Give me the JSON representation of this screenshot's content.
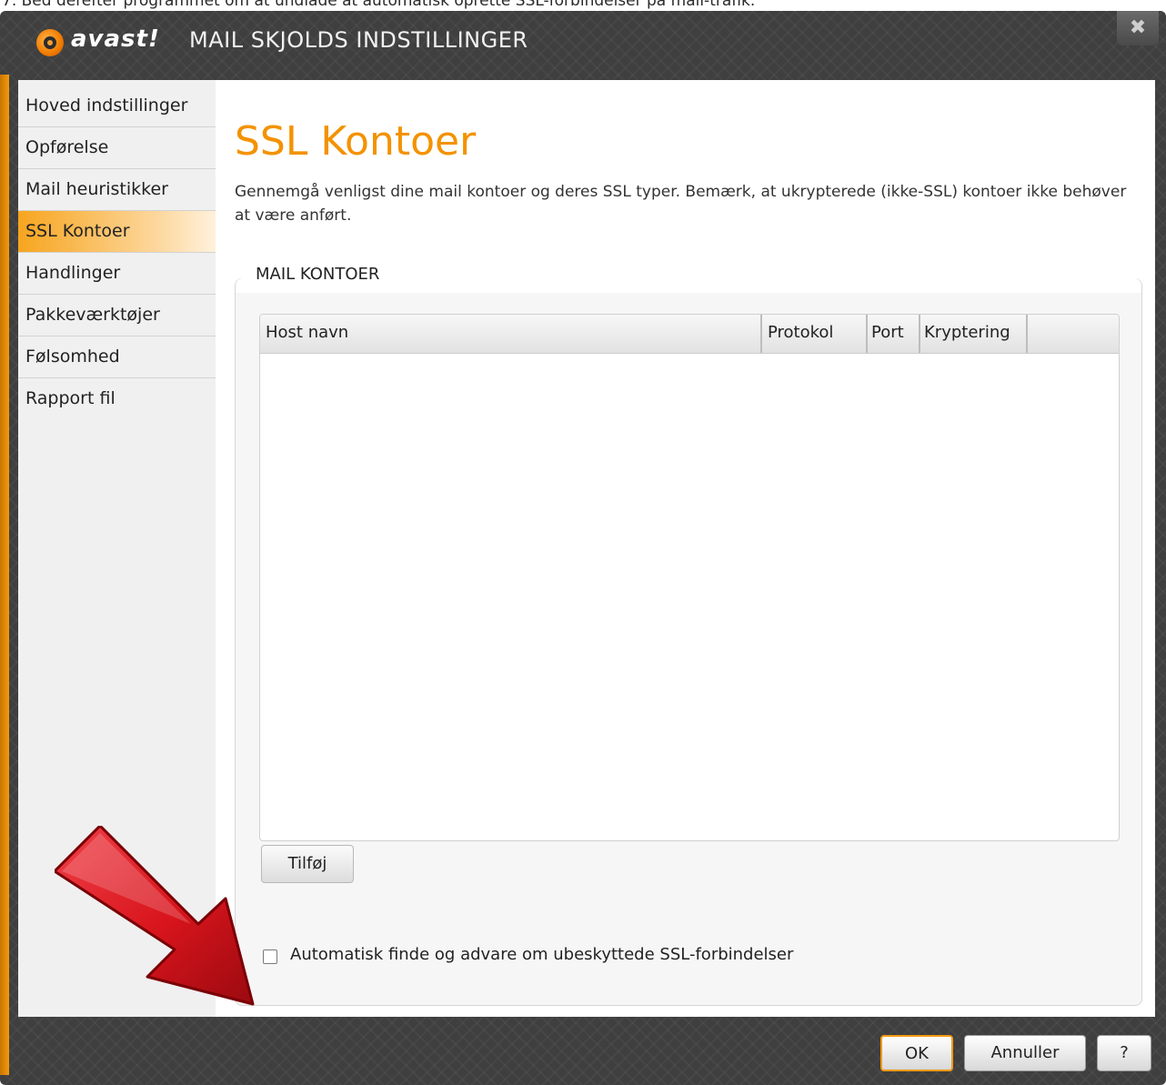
{
  "caption": "7. Bed derefter programmet om at undlade at automatisk oprette SSL-forbindelser på mail-trafik.",
  "window": {
    "logo_text": "avast!",
    "title": "MAIL SKJOLDS INDSTILLINGER",
    "close_glyph": "✖"
  },
  "sidebar": {
    "items": [
      {
        "label": "Hoved indstillinger"
      },
      {
        "label": "Opførelse"
      },
      {
        "label": "Mail heuristikker"
      },
      {
        "label": "SSL Kontoer"
      },
      {
        "label": "Handlinger"
      },
      {
        "label": "Pakkeværktøjer"
      },
      {
        "label": "Følsomhed"
      },
      {
        "label": "Rapport fil"
      }
    ],
    "active_index": 3
  },
  "main": {
    "title": "SSL Kontoer",
    "description": "Gennemgå venligst dine mail kontoer og deres SSL typer. Bemærk, at ukrypterede (ikke-SSL) kontoer ikke behøver at være anført.",
    "group_label": "MAIL KONTOER",
    "table": {
      "columns": [
        "Host navn",
        "Protokol",
        "Port",
        "Kryptering"
      ],
      "rows": []
    },
    "add_button": "Tilføj",
    "auto_detect_label": "Automatisk finde og advare om ubeskyttede SSL-forbindelser",
    "auto_detect_checked": false
  },
  "footer": {
    "ok": "OK",
    "cancel": "Annuller",
    "help": "?"
  },
  "colors": {
    "accent": "#f39200",
    "annotation_arrow": "#d8141c"
  },
  "annotation": {
    "icon": "red-arrow-icon"
  }
}
